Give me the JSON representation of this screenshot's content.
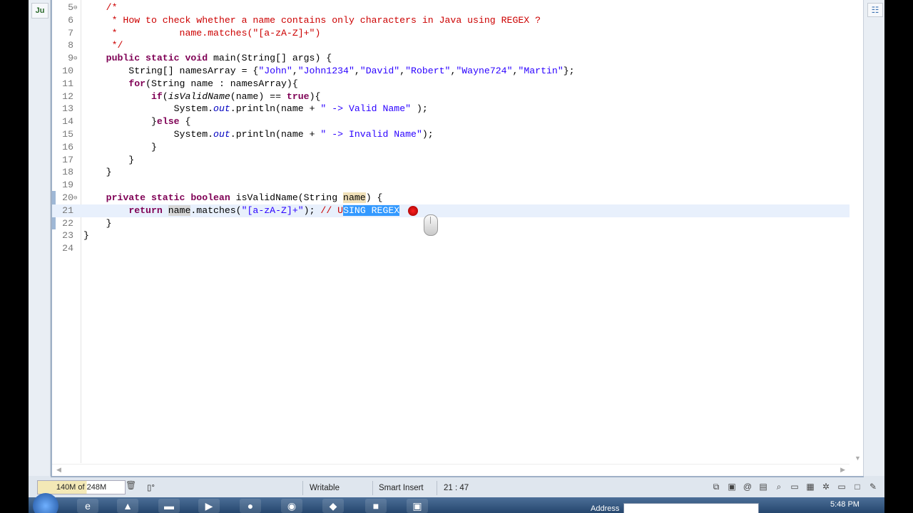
{
  "editor": {
    "lines": [
      {
        "n": "5",
        "fold": "⊖",
        "html": "    <span class=\"cm\">/*</span>"
      },
      {
        "n": "6",
        "html": "     <span class=\"cm\">* How to check whether a name contains only characters in Java using REGEX ?</span>"
      },
      {
        "n": "7",
        "html": "     <span class=\"cm\">*           name.matches(\"[a-zA-Z]+\")</span>"
      },
      {
        "n": "8",
        "html": "     <span class=\"cm\">*/</span>"
      },
      {
        "n": "9",
        "fold": "⊖",
        "html": "    <span class=\"kw\">public static void</span> main(String[] args) {"
      },
      {
        "n": "10",
        "html": "        String[] namesArray = {<span class=\"str\">\"John\"</span>,<span class=\"str\">\"John1234\"</span>,<span class=\"str\">\"David\"</span>,<span class=\"str\">\"Robert\"</span>,<span class=\"str\">\"Wayne724\"</span>,<span class=\"str\">\"Martin\"</span>};"
      },
      {
        "n": "11",
        "html": "        <span class=\"kw\">for</span>(String name : namesArray){"
      },
      {
        "n": "12",
        "html": "            <span class=\"kw\">if</span>(<span class=\"it\">isValidName</span>(name) == <span class=\"kw\">true</span>){"
      },
      {
        "n": "13",
        "html": "                System.<span class=\"it str\" style=\"color:#0000c0\">out</span>.println(name + <span class=\"str\">\" -> Valid Name\"</span> );"
      },
      {
        "n": "14",
        "html": "            }<span class=\"kw\">else</span> {"
      },
      {
        "n": "15",
        "html": "                System.<span class=\"it str\" style=\"color:#0000c0\">out</span>.println(name + <span class=\"str\">\" -> Invalid Name\"</span>);"
      },
      {
        "n": "16",
        "html": "            }"
      },
      {
        "n": "17",
        "html": "        }"
      },
      {
        "n": "18",
        "html": "    }"
      },
      {
        "n": "19",
        "html": ""
      },
      {
        "n": "20",
        "fold": "⊖",
        "html": "    <span class=\"kw\">private static boolean</span> isValidName(String <span class=\"occ2\">name</span>) {"
      },
      {
        "n": "21",
        "current": true,
        "html": "        <span class=\"kw\">return</span> <span class=\"occ\">name</span>.matches(<span class=\"str\">\"[a-zA-Z]+\"</span>); <span class=\"cm\">// U</span><span class=\"sel\">SING REGEX</span>"
      },
      {
        "n": "22",
        "html": "    }"
      },
      {
        "n": "23",
        "html": "}"
      },
      {
        "n": "24",
        "html": ""
      }
    ]
  },
  "status": {
    "heap": "140M of 248M",
    "writable": "Writable",
    "insert_mode": "Smart Insert",
    "position": "21 : 47"
  },
  "taskbar": {
    "address_label": "Address",
    "clock": "5:48 PM"
  }
}
